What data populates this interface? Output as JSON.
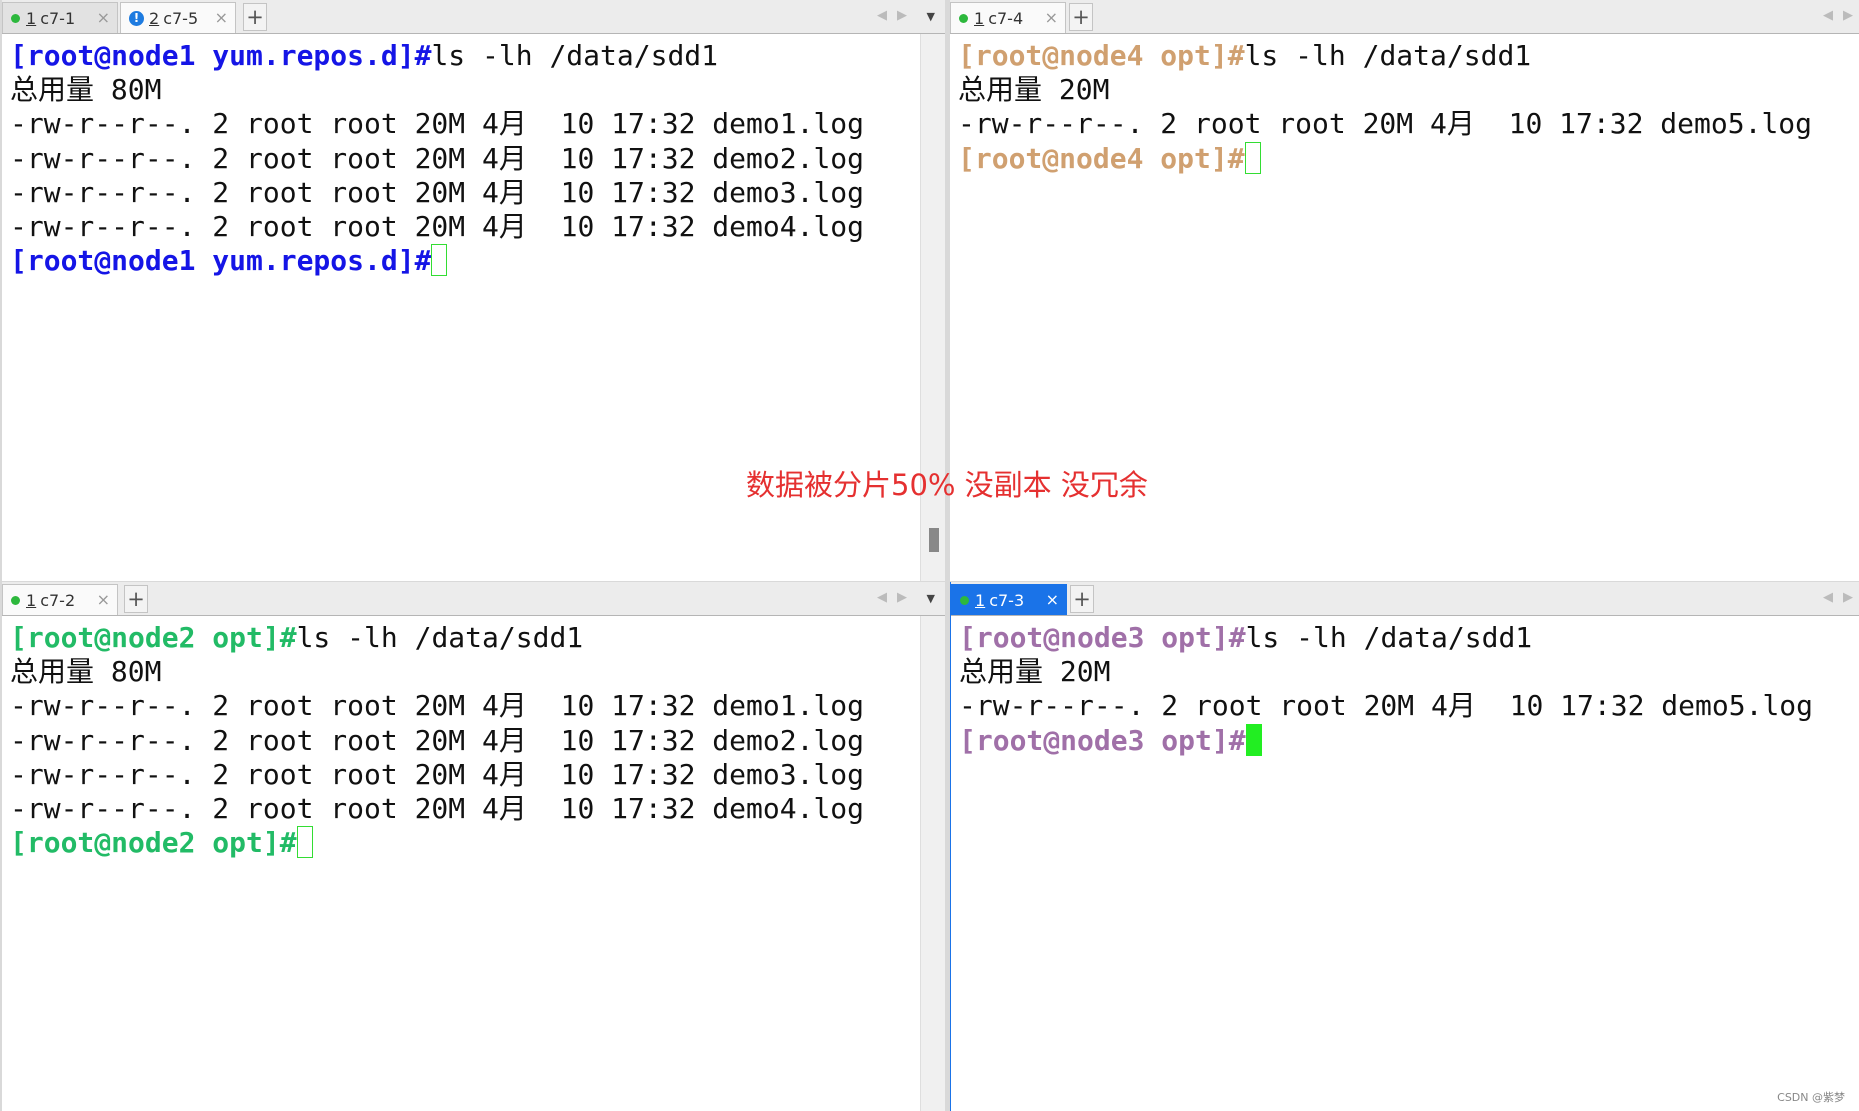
{
  "panes": {
    "top_left": {
      "tabs": [
        {
          "num": "1",
          "name": "c7-1"
        },
        {
          "num": "2",
          "name": "c7-5"
        }
      ],
      "prompt_color": "#1515e6",
      "lines": [
        {
          "prompt": "[root@node1 yum.repos.d]#",
          "text": "ls -lh /data/sdd1"
        },
        {
          "text": "总用量 80M"
        },
        {
          "text": "-rw-r--r--. 2 root root 20M 4月  10 17:32 demo1.log"
        },
        {
          "text": "-rw-r--r--. 2 root root 20M 4月  10 17:32 demo2.log"
        },
        {
          "text": "-rw-r--r--. 2 root root 20M 4月  10 17:32 demo3.log"
        },
        {
          "text": "-rw-r--r--. 2 root root 20M 4月  10 17:32 demo4.log"
        },
        {
          "prompt": "[root@node1 yum.repos.d]#",
          "text": ""
        }
      ]
    },
    "top_right": {
      "tabs": [
        {
          "num": "1",
          "name": "c7-4"
        }
      ],
      "prompt_color": "#d0a070",
      "lines": [
        {
          "prompt": "[root@node4 opt]#",
          "text": "ls -lh /data/sdd1"
        },
        {
          "text": "总用量 20M"
        },
        {
          "text": "-rw-r--r--. 2 root root 20M 4月  10 17:32 demo5.log"
        },
        {
          "prompt": "[root@node4 opt]#",
          "text": ""
        }
      ]
    },
    "bottom_left": {
      "tabs": [
        {
          "num": "1",
          "name": "c7-2"
        }
      ],
      "prompt_color": "#22bb66",
      "lines": [
        {
          "prompt": "[root@node2 opt]#",
          "text": "ls -lh /data/sdd1"
        },
        {
          "text": "总用量 80M"
        },
        {
          "text": "-rw-r--r--. 2 root root 20M 4月  10 17:32 demo1.log"
        },
        {
          "text": "-rw-r--r--. 2 root root 20M 4月  10 17:32 demo2.log"
        },
        {
          "text": "-rw-r--r--. 2 root root 20M 4月  10 17:32 demo3.log"
        },
        {
          "text": "-rw-r--r--. 2 root root 20M 4月  10 17:32 demo4.log"
        },
        {
          "prompt": "[root@node2 opt]#",
          "text": ""
        }
      ]
    },
    "bottom_right": {
      "tabs": [
        {
          "num": "1",
          "name": "c7-3"
        }
      ],
      "prompt_color": "#a070a8",
      "lines": [
        {
          "prompt": "[root@node3 opt]#",
          "text": "ls -lh /data/sdd1"
        },
        {
          "text": "总用量 20M"
        },
        {
          "text": "-rw-r--r--. 2 root root 20M 4月  10 17:32 demo5.log"
        },
        {
          "prompt": "[root@node3 opt]#",
          "text": ""
        }
      ]
    }
  },
  "annotation": "数据被分片50% 没副本 没冗余",
  "watermark": "CSDN @紫梦"
}
